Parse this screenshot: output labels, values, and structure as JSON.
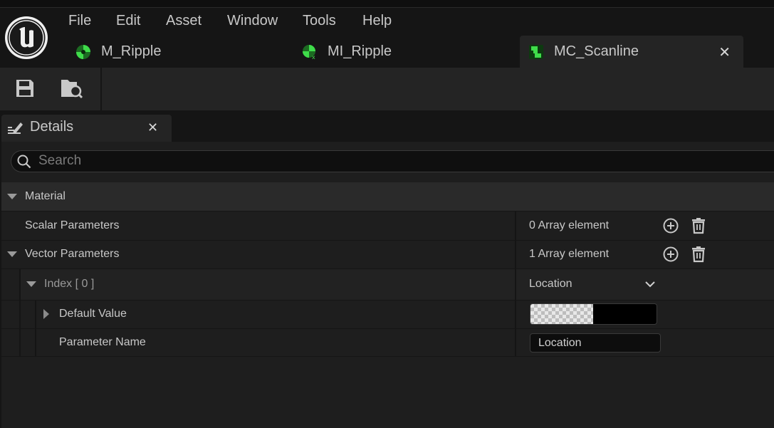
{
  "menu": {
    "items": [
      "File",
      "Edit",
      "Asset",
      "Window",
      "Tools",
      "Help"
    ]
  },
  "tabs": [
    {
      "label": "M_Ripple",
      "icon": "material-icon"
    },
    {
      "label": "MI_Ripple",
      "icon": "material-instance-icon"
    },
    {
      "label": "MC_Scanline",
      "icon": "material-collection-icon",
      "active": true
    }
  ],
  "toolbar": {
    "icons": [
      "save-icon",
      "browse-icon"
    ]
  },
  "details": {
    "title": "Details",
    "search_placeholder": "Search",
    "category": "Material",
    "rows": {
      "scalar_label": "Scalar Parameters",
      "scalar_value": "0 Array element",
      "vector_label": "Vector Parameters",
      "vector_value": "1 Array element",
      "index_label": "Index [ 0 ]",
      "index_value": "Location",
      "default_label": "Default Value",
      "param_name_label": "Parameter Name",
      "param_name_value": "Location"
    }
  },
  "colors": {
    "accent_green": "#2fbf3a",
    "panel_bg": "#1e1e1e",
    "tab_active_bg": "#242424"
  }
}
